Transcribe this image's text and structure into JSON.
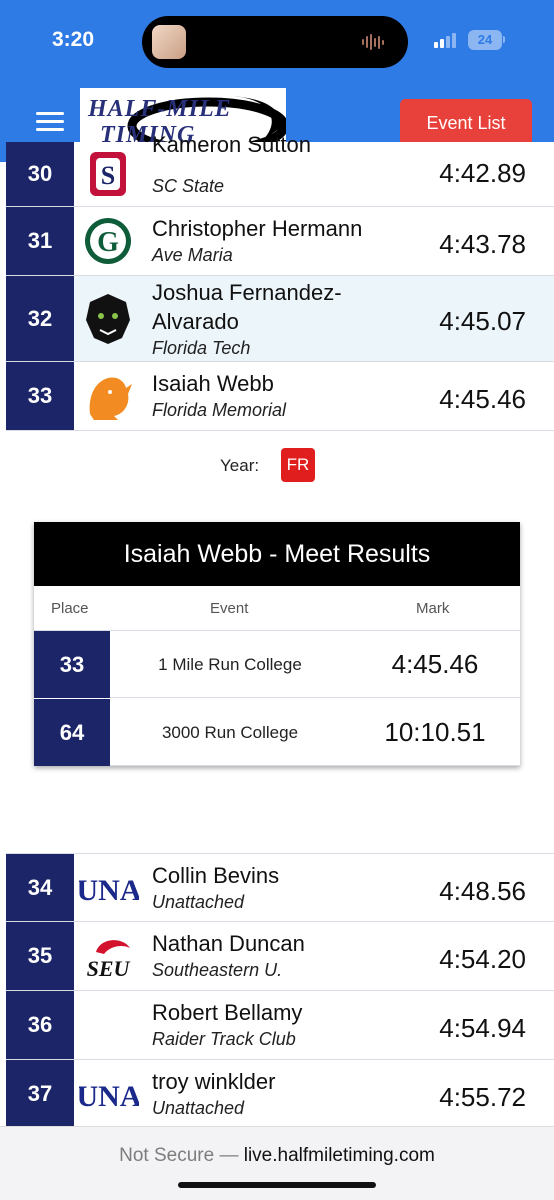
{
  "status_bar": {
    "time": "3:20",
    "battery": "24"
  },
  "header": {
    "logo_line1": "HALF-MILE",
    "logo_line2": "TIMING",
    "event_list_label": "Event List"
  },
  "results": [
    {
      "place": "30",
      "name": "Kameron Sutton",
      "team": "SC State",
      "mark": "4:42.89"
    },
    {
      "place": "31",
      "name": "Christopher Hermann",
      "team": "Ave Maria",
      "mark": "4:43.78"
    },
    {
      "place": "32",
      "name_line1": "Joshua Fernandez-",
      "name_line2": "Alvarado",
      "team": "Florida Tech",
      "mark": "4:45.07"
    },
    {
      "place": "33",
      "name": "Isaiah Webb",
      "team": "Florida Memorial",
      "mark": "4:45.46"
    },
    {
      "place": "34",
      "name": "Collin Bevins",
      "team": "Unattached",
      "mark": "4:48.56"
    },
    {
      "place": "35",
      "name": "Nathan Duncan",
      "team": "Southeastern U.",
      "mark": "4:54.20"
    },
    {
      "place": "36",
      "name": "Robert Bellamy",
      "team": "Raider Track Club",
      "mark": "4:54.94"
    },
    {
      "place": "37",
      "name": "troy winklder",
      "team": "Unattached",
      "mark": "4:55.72"
    }
  ],
  "logos": {
    "sc": "S",
    "ave": "G",
    "una": "UNA",
    "seu": "SEU"
  },
  "detail": {
    "year_label": "Year:",
    "year_value": "FR",
    "meet_title": "Isaiah Webb - Meet Results",
    "columns": [
      "Place",
      "Event",
      "Mark"
    ],
    "rows": [
      {
        "place": "33",
        "event": "1 Mile Run College",
        "mark": "4:45.46"
      },
      {
        "place": "64",
        "event": "3000 Run College",
        "mark": "10:10.51"
      }
    ]
  },
  "url_bar": {
    "prefix": "Not Secure —",
    "url": "live.halfmiletiming.com"
  }
}
